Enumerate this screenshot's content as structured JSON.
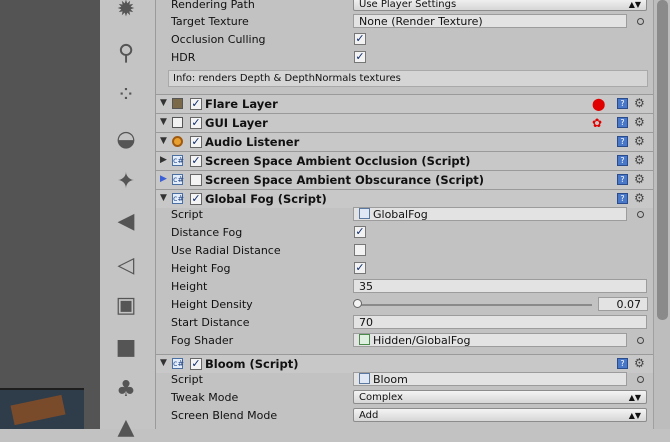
{
  "camera": {
    "rendering_path_label": "Rendering Path",
    "rendering_path_value": "Use Player Settings",
    "target_texture_label": "Target Texture",
    "target_texture_value": "None (Render Texture)",
    "occlusion_culling_label": "Occlusion Culling",
    "occlusion_culling_checked": true,
    "hdr_label": "HDR",
    "hdr_checked": true,
    "info": "Info: renders Depth & DepthNormals textures"
  },
  "components": [
    {
      "name": "Flare Layer",
      "enabled": true
    },
    {
      "name": "GUI Layer",
      "enabled": true
    },
    {
      "name": "Audio Listener",
      "enabled": true
    },
    {
      "name": "Screen Space Ambient Occlusion (Script)",
      "enabled": true
    },
    {
      "name": "Screen Space Ambient Obscurance (Script)",
      "enabled": false
    },
    {
      "name": "Global Fog (Script)",
      "enabled": true
    },
    {
      "name": "Bloom (Script)",
      "enabled": true
    }
  ],
  "global_fog": {
    "script_label": "Script",
    "script_value": "GlobalFog",
    "distance_fog_label": "Distance Fog",
    "distance_fog_checked": true,
    "use_radial_distance_label": "Use Radial Distance",
    "use_radial_distance_checked": false,
    "height_fog_label": "Height Fog",
    "height_fog_checked": true,
    "height_label": "Height",
    "height_value": "35",
    "height_density_label": "Height Density",
    "height_density_value": "0.07",
    "height_density_fraction": 0.0,
    "start_distance_label": "Start Distance",
    "start_distance_value": "70",
    "fog_shader_label": "Fog Shader",
    "fog_shader_value": "Hidden/GlobalFog"
  },
  "bloom": {
    "script_label": "Script",
    "script_value": "Bloom",
    "tweak_mode_label": "Tweak Mode",
    "tweak_mode_value": "Complex",
    "screen_blend_mode_label": "Screen Blend Mode",
    "screen_blend_mode_value": "Add"
  },
  "glyphs": {
    "check": "✓",
    "expand": "▶",
    "collapse": "▼",
    "dropdown": "▲▼",
    "gear": "⚙",
    "help": "?",
    "script": "c#"
  },
  "colors": {
    "panel": "#c2c2c2",
    "header": "#c8c8c8",
    "warning": "#e00000",
    "check": "#0d2b6e"
  }
}
